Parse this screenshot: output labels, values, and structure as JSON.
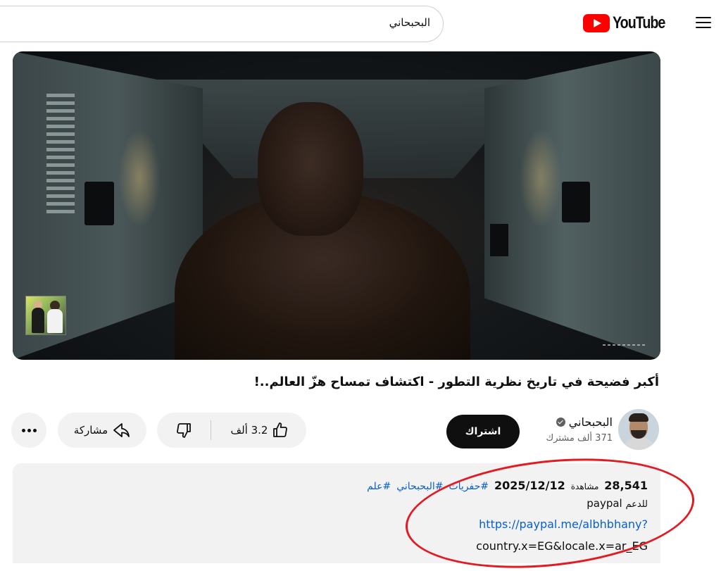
{
  "header": {
    "logo_text": "YouTube",
    "search_value": "البحبحاني",
    "brand_color": "#ff0000"
  },
  "video": {
    "title": "أكبر فضيحة في تاريخ نظرية التطور - اكتشاف تمساح هزّ العالم..!"
  },
  "channel": {
    "name": "البحبحاني",
    "verified": true,
    "subscribers": "371 ألف مشترك"
  },
  "actions": {
    "subscribe_label": "اشتراك",
    "like_count": "3.2 ألف",
    "share_label": "مشاركة"
  },
  "description": {
    "views": "28,541",
    "views_label": "مشاهدة",
    "date": "2025/12/12",
    "hashtags": [
      "#حفريات",
      "#البحبحاني",
      "#علم"
    ],
    "support_prefix": "للدعم",
    "support_word": "paypal",
    "paypal_link": "https://paypal.me/albhbhany?",
    "paypal_params": "country.x=EG&locale.x=ar_EG"
  },
  "icons": {
    "menu": "hamburger-icon",
    "like": "thumbs-up-icon",
    "dislike": "thumbs-down-icon",
    "share": "share-arrow-icon",
    "more": "more-horizontal-icon",
    "verified": "verified-check-icon"
  },
  "annotation_color": "#e21b23"
}
